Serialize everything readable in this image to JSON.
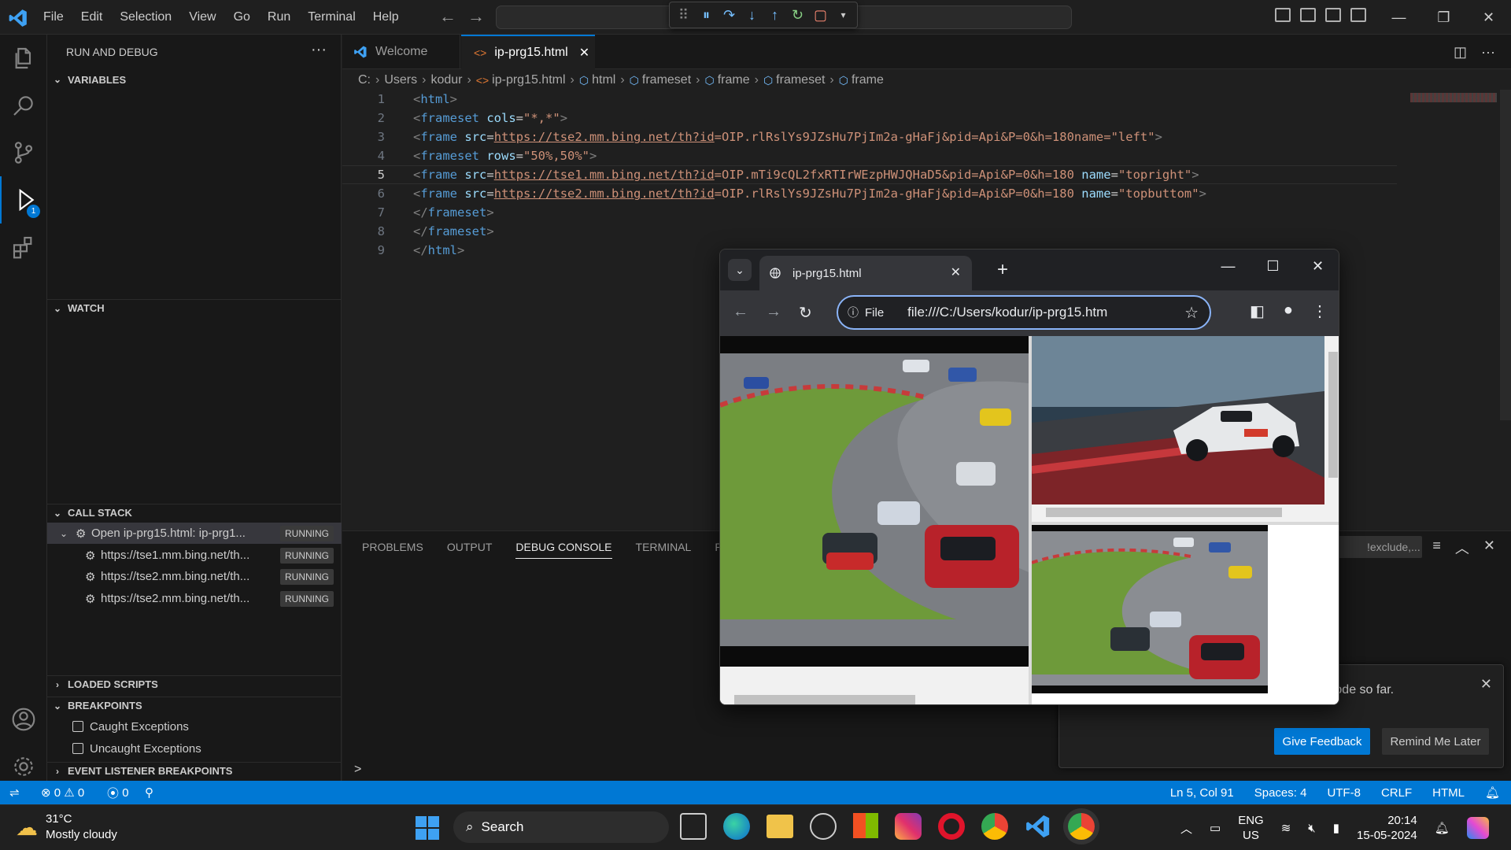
{
  "menu": [
    "File",
    "Edit",
    "Selection",
    "View",
    "Go",
    "Run",
    "Terminal",
    "Help"
  ],
  "activity_bar": {
    "debug_badge": "1"
  },
  "sidebar": {
    "title": "RUN AND DEBUG",
    "more": "···",
    "sections": {
      "variables": "VARIABLES",
      "watch": "WATCH",
      "call_stack": "CALL STACK",
      "loaded_scripts": "LOADED SCRIPTS",
      "breakpoints": "BREAKPOINTS",
      "event_listener": "EVENT LISTENER BREAKPOINTS"
    },
    "call_stack": [
      {
        "label": "Open ip-prg15.html: ip-prg1...",
        "state": "RUNNING"
      },
      {
        "label": "https://tse1.mm.bing.net/th...",
        "state": "RUNNING"
      },
      {
        "label": "https://tse2.mm.bing.net/th...",
        "state": "RUNNING"
      },
      {
        "label": "https://tse2.mm.bing.net/th...",
        "state": "RUNNING"
      }
    ],
    "breakpoints": [
      {
        "label": "Caught Exceptions",
        "checked": false
      },
      {
        "label": "Uncaught Exceptions",
        "checked": false
      }
    ]
  },
  "editor": {
    "tabs": [
      {
        "label": "Welcome",
        "active": false
      },
      {
        "label": "ip-prg15.html",
        "active": true
      }
    ],
    "breadcrumb": [
      "C:",
      "Users",
      "kodur",
      "ip-prg15.html",
      "html",
      "frameset",
      "frame",
      "frameset",
      "frame"
    ],
    "active_line": 5,
    "lines": [
      {
        "n": "1",
        "tokens": [
          [
            "tg",
            "<"
          ],
          [
            "tn",
            "html"
          ],
          [
            "tg",
            ">"
          ]
        ]
      },
      {
        "n": "2",
        "tokens": [
          [
            "tg",
            "<"
          ],
          [
            "tn",
            "frameset"
          ],
          [
            "tx",
            " "
          ],
          [
            "an",
            "cols"
          ],
          [
            "tx",
            "="
          ],
          [
            "av",
            "\"*,*\""
          ],
          [
            "tg",
            ">"
          ]
        ]
      },
      {
        "n": "3",
        "tokens": [
          [
            "tg",
            "<"
          ],
          [
            "tn",
            "frame"
          ],
          [
            "tx",
            " "
          ],
          [
            "an",
            "src"
          ],
          [
            "tx",
            "="
          ],
          [
            "url",
            "https://tse2.mm.bing.net/th?id"
          ],
          [
            "av",
            "=OIP.rlRslYs9JZsHu7PjIm2a-gHaFj&pid=Api&P=0&h=180name=\"left\""
          ],
          [
            "tg",
            ">"
          ]
        ]
      },
      {
        "n": "4",
        "tokens": [
          [
            "tg",
            "<"
          ],
          [
            "tn",
            "frameset"
          ],
          [
            "tx",
            " "
          ],
          [
            "an",
            "rows"
          ],
          [
            "tx",
            "="
          ],
          [
            "av",
            "\"50%,50%\""
          ],
          [
            "tg",
            ">"
          ]
        ]
      },
      {
        "n": "5",
        "tokens": [
          [
            "tg",
            "<"
          ],
          [
            "tn",
            "frame"
          ],
          [
            "tx",
            " "
          ],
          [
            "an",
            "src"
          ],
          [
            "tx",
            "="
          ],
          [
            "url",
            "https://tse1.mm.bing.net/th?id"
          ],
          [
            "av",
            "=OIP.mTi9cQL2fxRTIrWEzpHWJQHaD5&pid=Api&P=0&h=180 "
          ],
          [
            "an",
            "name"
          ],
          [
            "tx",
            "="
          ],
          [
            "av",
            "\"topright\""
          ],
          [
            "tg",
            ">"
          ]
        ]
      },
      {
        "n": "6",
        "tokens": [
          [
            "tg",
            "<"
          ],
          [
            "tn",
            "frame"
          ],
          [
            "tx",
            " "
          ],
          [
            "an",
            "src"
          ],
          [
            "tx",
            "="
          ],
          [
            "url",
            "https://tse2.mm.bing.net/th?id"
          ],
          [
            "av",
            "=OIP.rlRslYs9JZsHu7PjIm2a-gHaFj&pid=Api&P=0&h=180 "
          ],
          [
            "an",
            "name"
          ],
          [
            "tx",
            "="
          ],
          [
            "av",
            "\"topbuttom\""
          ],
          [
            "tg",
            ">"
          ]
        ]
      },
      {
        "n": "7",
        "tokens": [
          [
            "tg",
            "</"
          ],
          [
            "tn",
            "frameset"
          ],
          [
            "tg",
            ">"
          ]
        ]
      },
      {
        "n": "8",
        "tokens": [
          [
            "tg",
            "</"
          ],
          [
            "tn",
            "frameset"
          ],
          [
            "tg",
            ">"
          ]
        ]
      },
      {
        "n": "9",
        "tokens": [
          [
            "tg",
            "</"
          ],
          [
            "tn",
            "html"
          ],
          [
            "tg",
            ">"
          ]
        ]
      }
    ]
  },
  "panel": {
    "tabs": [
      "PROBLEMS",
      "OUTPUT",
      "DEBUG CONSOLE",
      "TERMINAL",
      "PORTS"
    ],
    "selected_tab": "DEBUG CONSOLE",
    "filter_placeholder": "!exclude,...",
    "prompt": ">"
  },
  "notification": {
    "message": "ease tell us about your experience with VS Code so far.",
    "primary": "Give Feedback",
    "secondary": "Remind Me Later"
  },
  "statusbar": {
    "errors": "0",
    "warnings": "0",
    "ports": "0",
    "position": "Ln 5, Col 91",
    "spaces": "Spaces: 4",
    "encoding": "UTF-8",
    "eol": "CRLF",
    "language": "HTML"
  },
  "browser": {
    "tab_title": "ip-prg15.html",
    "chip": "File",
    "url": "file:///C:/Users/kodur/ip-prg15.htm"
  },
  "taskbar": {
    "temperature": "31°C",
    "weather": "Mostly cloudy",
    "search": "Search",
    "lang_line1": "ENG",
    "lang_line2": "US",
    "time": "20:14",
    "date": "15-05-2024"
  },
  "colors": {
    "accent": "#0078d4",
    "statusbar": "#0078d4",
    "editor_bg": "#1f1f1f",
    "sidebar_bg": "#181818",
    "taskbar_bg": "#202020"
  }
}
